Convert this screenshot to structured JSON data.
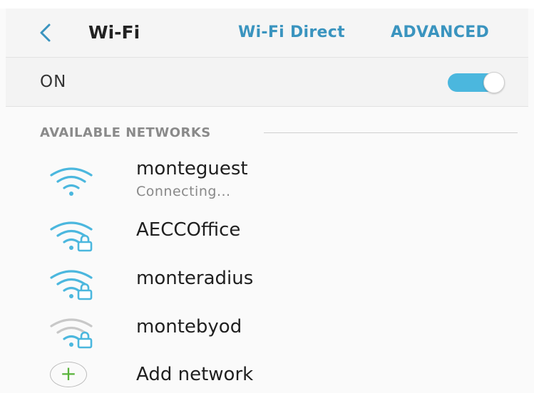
{
  "appbar": {
    "title": "Wi-Fi",
    "actions": {
      "wifi_direct": "Wi-Fi Direct",
      "advanced": "ADVANCED"
    }
  },
  "master_switch": {
    "label": "ON",
    "enabled": true
  },
  "available": {
    "header": "AVAILABLE NETWORKS",
    "networks": [
      {
        "name": "monteguest",
        "status": "Connecting...",
        "secured": false,
        "signal": "strong"
      },
      {
        "name": "AECCOffice",
        "secured": true,
        "signal": "strong"
      },
      {
        "name": "monteradius",
        "secured": true,
        "signal": "strong"
      },
      {
        "name": "montebyod",
        "secured": true,
        "signal": "weak"
      }
    ],
    "add_network": {
      "label": "Add network",
      "icon": "plus-icon"
    }
  },
  "colors": {
    "accent": "#3a94bf",
    "toggle_on": "#4bb7de",
    "wifi_strong": "#4bb7de",
    "wifi_weak": "#c8c8c8",
    "plus": "#58b33a"
  }
}
